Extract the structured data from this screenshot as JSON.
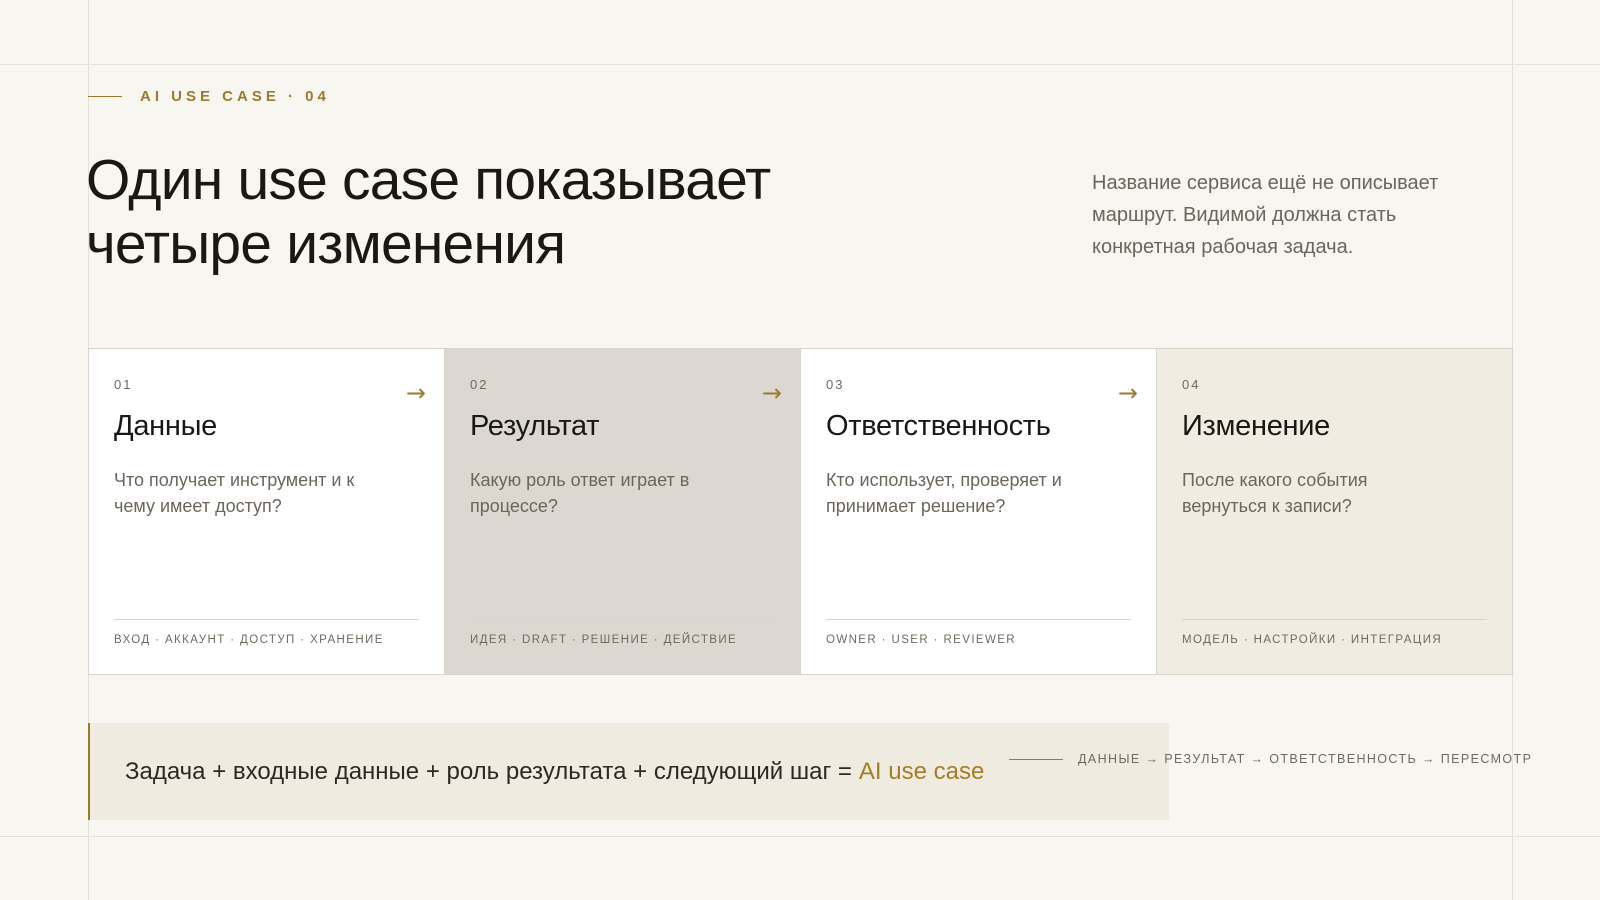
{
  "eyebrow": "AI USE CASE · 04",
  "title_line1": "Один use case показывает",
  "title_line2": "четыре изменения",
  "lead": "Название сервиса ещё не описывает маршрут. Видимой должна стать конкретная рабочая задача.",
  "cards": [
    {
      "num": "01",
      "title": "Данные",
      "desc": "Что получает инструмент и к чему имеет доступ?",
      "tags": "ВХОД · АККАУНТ · ДОСТУП · ХРАНЕНИЕ",
      "arrow": "→",
      "bg": "#ffffff"
    },
    {
      "num": "02",
      "title": "Результат",
      "desc": "Какую роль ответ играет в процессе?",
      "tags": "ИДЕЯ · DRAFT · РЕШЕНИЕ · ДЕЙСТВИЕ",
      "arrow": "→",
      "bg": "#dcd7d1"
    },
    {
      "num": "03",
      "title": "Ответственность",
      "desc": "Кто использует, проверяет и принимает решение?",
      "tags": "OWNER · USER · REVIEWER",
      "arrow": "→",
      "bg": "#ffffff"
    },
    {
      "num": "04",
      "title": "Изменение",
      "desc": "После какого события вернуться к записи?",
      "tags": "МОДЕЛЬ · НАСТРОЙКИ · ИНТЕГРАЦИЯ",
      "arrow": "",
      "bg": "#f1ece2"
    }
  ],
  "formula": {
    "text": "Задача + входные данные + роль результата + следующий шаг =",
    "accent": "AI use case"
  },
  "flow": "ДАННЫЕ → РЕЗУЛЬТАТ → ОТВЕТСТВЕННОСТЬ → ПЕРЕСМОТР",
  "colors": {
    "accent": "#9a7a2c",
    "background": "#f8f6f1",
    "text": "#1d1b17",
    "muted": "#6b655b"
  }
}
